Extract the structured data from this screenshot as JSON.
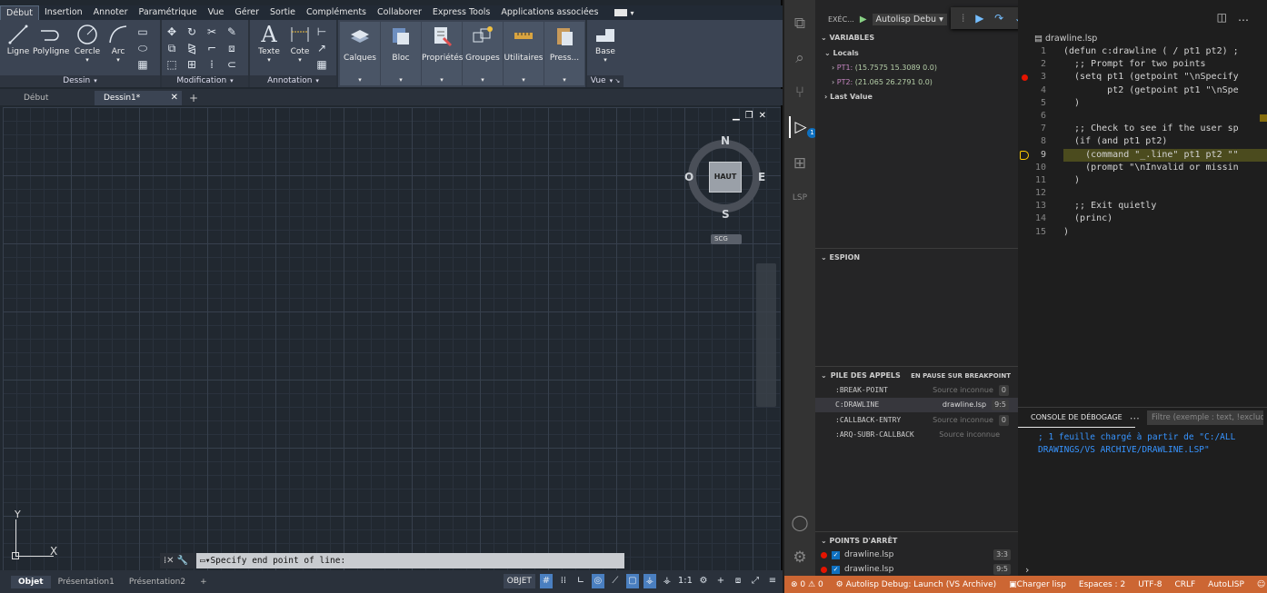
{
  "autocad": {
    "ribbon_tabs": [
      "Début",
      "Insertion",
      "Annoter",
      "Paramétrique",
      "Vue",
      "Gérer",
      "Sortie",
      "Compléments",
      "Collaborer",
      "Express Tools",
      "Applications associées"
    ],
    "tools": {
      "ligne": "Ligne",
      "polyligne": "Polyligne",
      "cercle": "Cercle",
      "arc": "Arc",
      "texte": "Texte",
      "cote": "Cote",
      "calques": "Calques",
      "bloc": "Bloc",
      "proprietes": "Propriétés",
      "groupes": "Groupes",
      "utilitaires": "Utilitaires",
      "presse": "Press...",
      "base": "Base"
    },
    "panels": {
      "dessin": "Dessin",
      "modification": "Modification",
      "annotation": "Annotation",
      "vue": "Vue"
    },
    "doc_tabs": {
      "debut": "Début",
      "dessin1": "Dessin1*"
    },
    "viewcube": {
      "n": "N",
      "s": "S",
      "e": "E",
      "o": "O",
      "face": "HAUT",
      "scg": "SCG"
    },
    "ucs": {
      "x": "X",
      "y": "Y"
    },
    "command_prompt": "Specify end point of line:",
    "layout_tabs": [
      "Objet",
      "Présentation1",
      "Présentation2"
    ],
    "status": {
      "objet": "OBJET",
      "scale": "1:1"
    }
  },
  "vscode": {
    "debug_label": "EXÉC...",
    "debug_config": "Autolisp Debu",
    "variables_header": "VARIABLES",
    "locals_label": "Locals",
    "vars": [
      {
        "name": "PT1:",
        "value": "(15.7575 15.3089 0.0)"
      },
      {
        "name": "PT2:",
        "value": "(21.065 26.2791 0.0)"
      }
    ],
    "last_value_label": "Last Value",
    "espion_header": "ESPION",
    "callstack_header": "PILE DES APPELS",
    "callstack_status": "EN PAUSE SUR BREAKPOINT",
    "callstack": [
      {
        "name": ":BREAK-POINT",
        "src": "Source inconnue",
        "pos": "0"
      },
      {
        "name": "C:DRAWLINE",
        "src": "drawline.lsp",
        "pos": "9:5"
      },
      {
        "name": ":CALLBACK-ENTRY",
        "src": "Source inconnue",
        "pos": "0"
      },
      {
        "name": ":ARQ-SUBR-CALLBACK",
        "src": "Source inconnue",
        "pos": ""
      }
    ],
    "breakpoints_header": "POINTS D'ARRÊT",
    "breakpoints": [
      {
        "file": "drawline.lsp",
        "pos": "3:3"
      },
      {
        "file": "drawline.lsp",
        "pos": "9:5"
      }
    ],
    "breadcrumb": "drawline.lsp",
    "code_lines": [
      {
        "n": "1",
        "text": "(defun c:drawline ( / pt1 pt2) ;"
      },
      {
        "n": "2",
        "text": "  ;; Prompt for two points"
      },
      {
        "n": "3",
        "text": "  (setq pt1 (getpoint \"\\nSpecify"
      },
      {
        "n": "4",
        "text": "        pt2 (getpoint pt1 \"\\nSpe"
      },
      {
        "n": "5",
        "text": "  )"
      },
      {
        "n": "6",
        "text": ""
      },
      {
        "n": "7",
        "text": "  ;; Check to see if the user sp"
      },
      {
        "n": "8",
        "text": "  (if (and pt1 pt2)"
      },
      {
        "n": "9",
        "text": "    (command \"_.line\" pt1 pt2 \"\""
      },
      {
        "n": "10",
        "text": "    (prompt \"\\nInvalid or missin"
      },
      {
        "n": "11",
        "text": "  )"
      },
      {
        "n": "12",
        "text": ""
      },
      {
        "n": "13",
        "text": "  ;; Exit quietly"
      },
      {
        "n": "14",
        "text": "  (princ)"
      },
      {
        "n": "15",
        "text": ")"
      }
    ],
    "console_tab": "CONSOLE DE DÉBOGAGE",
    "console_filter_placeholder": "Filtre (exemple : text, !exclude)",
    "console_output": "; 1 feuille chargé à partir de \"C:/ALL DRAWINGS/VS ARCHIVE/DRAWLINE.LSP\"",
    "statusbar": {
      "errors": "0",
      "warnings": "0",
      "launch": "Autolisp Debug: Launch (VS Archive)",
      "charger": "Charger lisp",
      "spaces": "Espaces : 2",
      "encoding": "UTF-8",
      "eol": "CRLF",
      "language": "AutoLISP"
    },
    "activity_badge": "1"
  },
  "colors": {
    "vscode_status": "#cc6633",
    "breakpoint": "#e51400",
    "autocad_bg": "#212830"
  }
}
